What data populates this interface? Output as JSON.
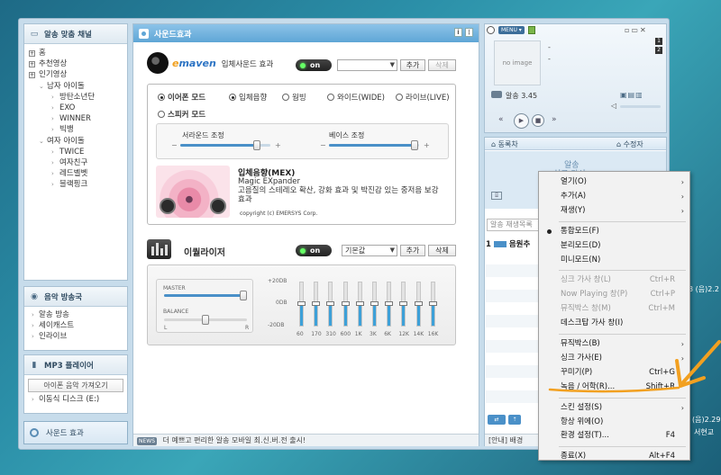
{
  "sidebar": {
    "channel_title": "알송 맞춤 채널",
    "tree": [
      {
        "label": "홈",
        "level": 0,
        "kind": "box"
      },
      {
        "label": "추천영상",
        "level": 0,
        "kind": "box"
      },
      {
        "label": "인기영상",
        "level": 0,
        "kind": "box"
      },
      {
        "label": "남자 아이돌",
        "level": 1,
        "kind": "open"
      },
      {
        "label": "방탄소년단",
        "level": 2,
        "kind": "leaf"
      },
      {
        "label": "EXO",
        "level": 2,
        "kind": "leaf"
      },
      {
        "label": "WINNER",
        "level": 2,
        "kind": "leaf"
      },
      {
        "label": "빅뱅",
        "level": 2,
        "kind": "leaf"
      },
      {
        "label": "여자 아이돌",
        "level": 1,
        "kind": "open"
      },
      {
        "label": "TWICE",
        "level": 2,
        "kind": "leaf"
      },
      {
        "label": "여자친구",
        "level": 2,
        "kind": "leaf"
      },
      {
        "label": "레드벨벳",
        "level": 2,
        "kind": "leaf"
      },
      {
        "label": "블랙핑크",
        "level": 2,
        "kind": "leaf"
      }
    ],
    "radio_title": "음악 방송국",
    "radio_items": [
      "알송 방송",
      "세이캐스트",
      "인라이브"
    ],
    "mp3_title": "MP3 플레이어",
    "mp3_button": "아이폰 음악 가져오기",
    "mp3_items": [
      "이동식 디스크 (E:)"
    ],
    "sound_tab": "사운드 효과"
  },
  "main": {
    "title": "사운드효과",
    "mex": {
      "brand_e": "e",
      "brand": "maven",
      "label": "입체사운드 효과",
      "toggle": "on",
      "add": "추가",
      "delete": "삭제",
      "modes": [
        "이어폰 모드",
        "스피커 모드"
      ],
      "options": [
        "입체음향",
        "웜빙",
        "와이드(WIDE)",
        "라이브(LIVE)"
      ],
      "slider1_label": "서라운드 조정",
      "slider2_label": "베이스 조정",
      "slider1_value": 0.85,
      "slider2_value": 0.95,
      "desc_title": "입체음향(MEX)",
      "desc_sub": "Magic EXpander",
      "desc_text": "고음질의 스테레오 확산, 강화 효과 및 박진감 있는 중저음 보강 효과",
      "copyright": "copyright (c) EMERSYS Corp."
    },
    "eq": {
      "title": "이퀄라이저",
      "toggle": "on",
      "preset": "기본값",
      "add": "추가",
      "delete": "삭제",
      "master_label": "MASTER",
      "balance_label": "BALANCE",
      "balance_l": "L",
      "balance_r": "R",
      "db_top": "+20DB",
      "db_mid": "0DB",
      "db_bot": "-20DB",
      "bands": [
        "60",
        "170",
        "310",
        "600",
        "1K",
        "3K",
        "6K",
        "12K",
        "14K",
        "16K"
      ]
    },
    "footer_tag": "NEWS",
    "footer_text": "더 예쁘고 편리한 알송 모바일 최.신.버.전 출시!"
  },
  "player": {
    "menu_label": "MENU",
    "noimage": "no image",
    "title_line": "-",
    "artist_line": "-",
    "song_label": "알송",
    "version": "3.45",
    "track_side": [
      "1",
      "2"
    ]
  },
  "playlist": {
    "tab_left": "동록차",
    "tab_right": "수정자",
    "lyrics1": "알송",
    "lyrics2": "싱크 가사",
    "search_placeholder": "알송 재생목록",
    "row1_num": "1",
    "row1_text": "음원추",
    "footer_text": "[안내] 배경",
    "right_edge_1": "3 (음)2.2",
    "right_edge_2": "(음)2.29",
    "right_edge_3": "서현교"
  },
  "context_menu": {
    "items": [
      {
        "label": "열기(O)",
        "submenu": true
      },
      {
        "label": "추가(A)",
        "submenu": true
      },
      {
        "label": "재생(Y)",
        "submenu": true
      },
      {
        "sep": true
      },
      {
        "label": "통합모드(F)",
        "selected": true
      },
      {
        "label": "분리모드(D)"
      },
      {
        "label": "미니모드(N)"
      },
      {
        "sep": true
      },
      {
        "label": "싱크 가사 창(L)",
        "shortcut": "Ctrl+R",
        "disabled": true
      },
      {
        "label": "Now Playing 창(P)",
        "shortcut": "Ctrl+P",
        "disabled": true
      },
      {
        "label": "뮤직박스 창(M)",
        "shortcut": "Ctrl+M",
        "disabled": true
      },
      {
        "label": "데스크탑 가사 창(I)"
      },
      {
        "sep": true
      },
      {
        "label": "뮤직박스(B)",
        "submenu": true
      },
      {
        "label": "싱크 가사(E)",
        "submenu": true
      },
      {
        "label": "꾸미기(P)",
        "shortcut": "Ctrl+G"
      },
      {
        "label": "녹음 / 어학(R)...",
        "shortcut": "Shift+R",
        "highlighted": true
      },
      {
        "sep": true
      },
      {
        "label": "스킨 설정(S)",
        "submenu": true
      },
      {
        "label": "항상 위에(O)"
      },
      {
        "label": "환경 설정(T)...",
        "shortcut": "F4"
      },
      {
        "sep": true
      },
      {
        "label": "종료(X)",
        "shortcut": "Alt+F4"
      }
    ]
  },
  "colors": {
    "accent": "#5fa6d6",
    "annotation": "#f2a020",
    "eq_fill": "#3da0d8"
  }
}
